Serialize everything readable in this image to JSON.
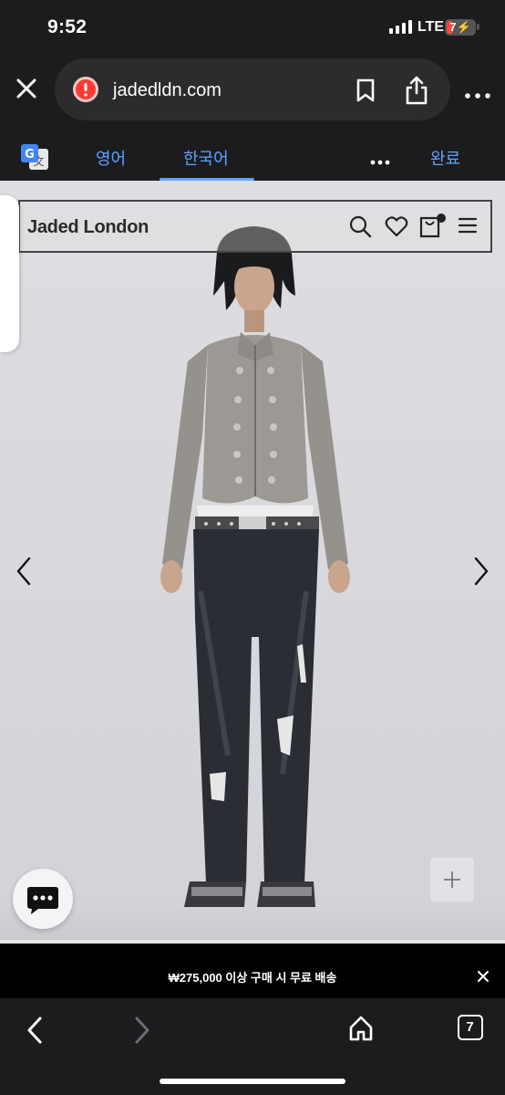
{
  "status_bar": {
    "time": "9:52",
    "network": "LTE",
    "battery_level": "7",
    "battery_color": "#ff453a"
  },
  "browser": {
    "url": "jadedldn.com",
    "translate": {
      "tabs": [
        "영어",
        "한국어"
      ],
      "selected_tab": "한국어",
      "done_label": "완료"
    },
    "tabs_count": "7"
  },
  "site": {
    "brand": "Jaded London",
    "header_icons": [
      "search-icon",
      "heart-icon",
      "cart-icon",
      "menu-icon"
    ],
    "promo_text": "₩275,000 이상 구매 시 무료 배송"
  },
  "colors": {
    "accent": "#5ea3ff",
    "chrome_bg": "#1c1c1e",
    "page_bg": "#dcdce0",
    "promo_bg": "#000000"
  }
}
